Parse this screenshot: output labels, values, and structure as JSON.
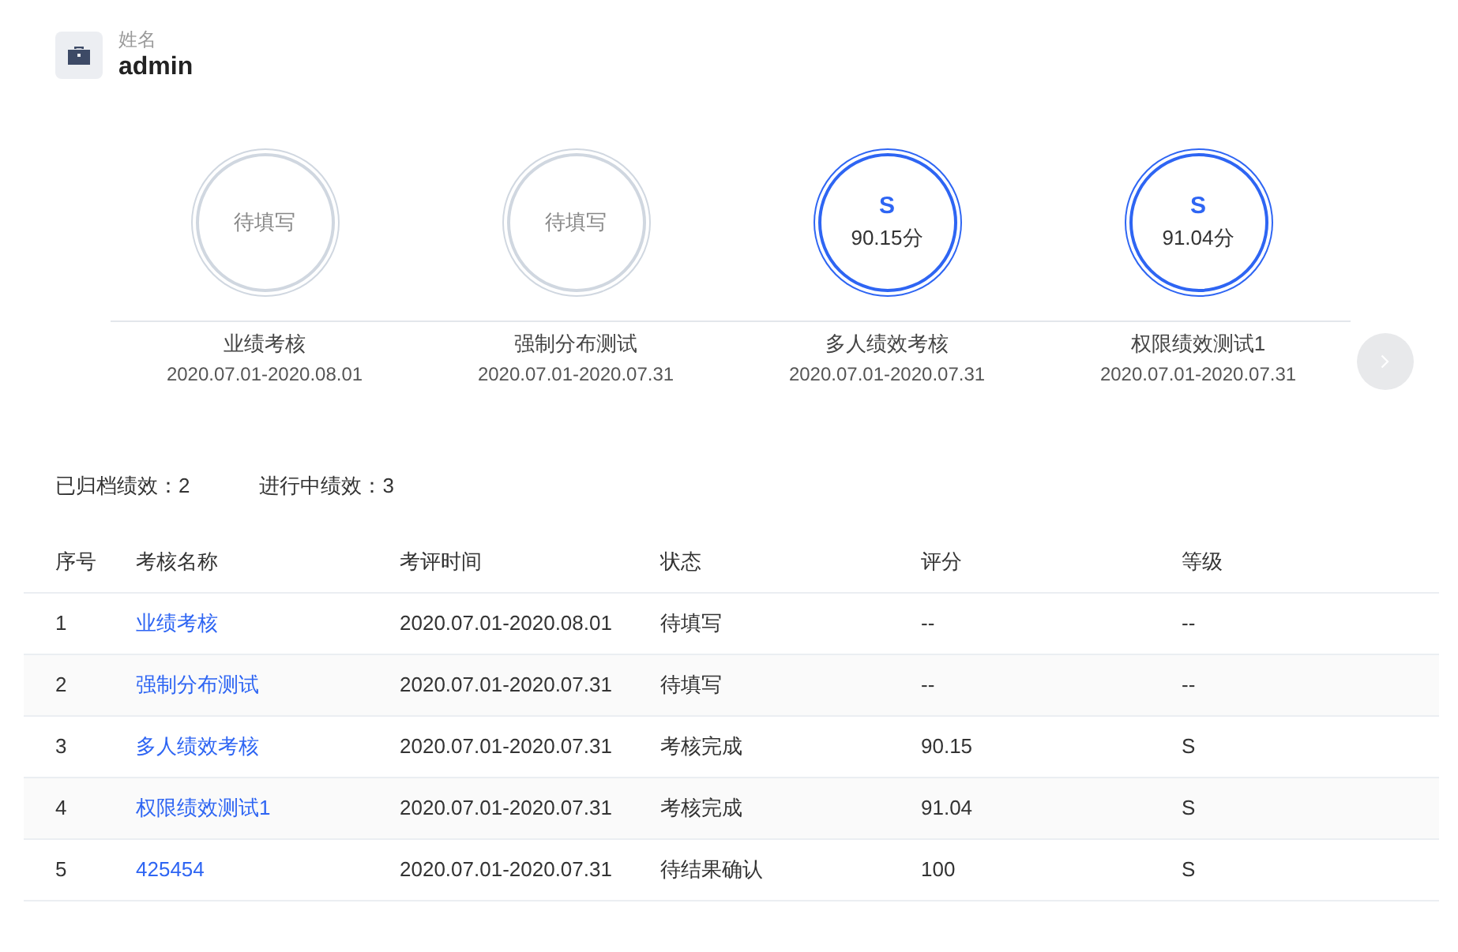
{
  "profile": {
    "label": "姓名",
    "name": "admin"
  },
  "stages": [
    {
      "kind": "pending",
      "status": "待填写",
      "title": "业绩考核",
      "period": "2020.07.01-2020.08.01"
    },
    {
      "kind": "pending",
      "status": "待填写",
      "title": "强制分布测试",
      "period": "2020.07.01-2020.07.31"
    },
    {
      "kind": "done",
      "grade": "S",
      "score": "90.15分",
      "title": "多人绩效考核",
      "period": "2020.07.01-2020.07.31"
    },
    {
      "kind": "done",
      "grade": "S",
      "score": "91.04分",
      "title": "权限绩效测试1",
      "period": "2020.07.01-2020.07.31"
    }
  ],
  "next_button": {
    "disabled": true
  },
  "summary": [
    "已归档绩效：2",
    "进行中绩效：3"
  ],
  "table": {
    "columns": [
      "序号",
      "考核名称",
      "考评时间",
      "状态",
      "评分",
      "等级"
    ],
    "rows": [
      [
        "1",
        "业绩考核",
        "2020.07.01-2020.08.01",
        "待填写",
        "--",
        "--"
      ],
      [
        "2",
        "强制分布测试",
        "2020.07.01-2020.07.31",
        "待填写",
        "--",
        "--"
      ],
      [
        "3",
        "多人绩效考核",
        "2020.07.01-2020.07.31",
        "考核完成",
        "90.15",
        "S"
      ],
      [
        "4",
        "权限绩效测试1",
        "2020.07.01-2020.07.31",
        "考核完成",
        "91.04",
        "S"
      ],
      [
        "5",
        "425454",
        "2020.07.01-2020.07.31",
        "待结果确认",
        "100",
        "S"
      ]
    ]
  }
}
